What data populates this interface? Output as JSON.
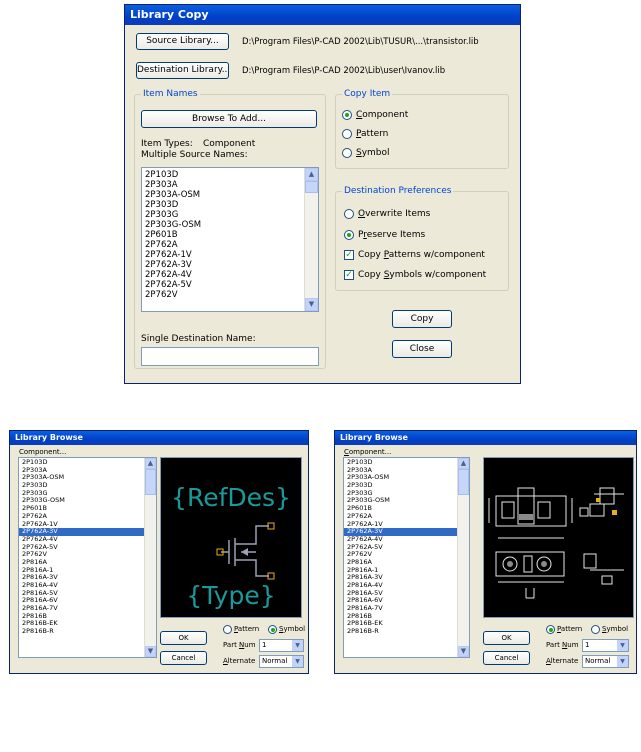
{
  "library_copy": {
    "title": "Library Copy",
    "source_button": "Source Library...",
    "source_path": "D:\\Program Files\\P-CAD 2002\\Lib\\TUSUR\\...\\transistor.lib",
    "destination_button": "Destination Library...",
    "destination_path": "D:\\Program Files\\P-CAD 2002\\Lib\\user\\Ivanov.lib",
    "item_names_group": "Item Names",
    "browse_button": "Browse To Add...",
    "item_types_label": "Item Types:",
    "item_types_value": "Component",
    "multiple_source_label": "Multiple Source Names:",
    "items": [
      "2P103D",
      "2P303A",
      "2P303A-OSM",
      "2P303D",
      "2P303G",
      "2P303G-OSM",
      "2P601B",
      "2P762A",
      "2P762A-1V",
      "2P762A-3V",
      "2P762A-4V",
      "2P762A-5V",
      "2P762V"
    ],
    "single_dest_label": "Single Destination Name:",
    "single_dest_value": "",
    "copy_item_group": "Copy Item",
    "copy_item_options": [
      "Component",
      "Pattern",
      "Symbol"
    ],
    "copy_item_selected": "Component",
    "dest_pref_group": "Destination Preferences",
    "overwrite_label": "Overwrite Items",
    "preserve_label": "Preserve Items",
    "preserve_selected": true,
    "copy_patterns_label": "Copy Patterns w/component",
    "copy_patterns_checked": true,
    "copy_symbols_label": "Copy Symbols w/component",
    "copy_symbols_checked": true,
    "copy_button": "Copy",
    "close_button": "Close"
  },
  "browse_left": {
    "title": "Library Browse",
    "component_label": "Component...",
    "items": [
      "2P103D",
      "2P303A",
      "2P303A-OSM",
      "2P303D",
      "2P303G",
      "2P303G-OSM",
      "2P601B",
      "2P762A",
      "2P762A-1V",
      "2P762A-3V",
      "2P762A-4V",
      "2P762A-5V",
      "2P762V",
      "2P816A",
      "2P816A-1",
      "2P816A-3V",
      "2P816A-4V",
      "2P816A-5V",
      "2P816A-6V",
      "2P816A-7V",
      "2P816B",
      "2P816B-EK",
      "2P816B-R"
    ],
    "selected_item": "2P762A-3V",
    "preview_refdes": "{RefDes}",
    "preview_type": "{Type}",
    "ok_button": "OK",
    "cancel_button": "Cancel",
    "pattern_label": "Pattern",
    "symbol_label": "Symbol",
    "view_selected": "Symbol",
    "part_num_label": "Part Num",
    "part_num_value": "1",
    "alternate_label": "Alternate",
    "alternate_value": "Normal"
  },
  "browse_right": {
    "title": "Library Browse",
    "component_label": "Component...",
    "items": [
      "2P103D",
      "2P303A",
      "2P303A-OSM",
      "2P303D",
      "2P303G",
      "2P303G-OSM",
      "2P601B",
      "2P762A",
      "2P762A-1V",
      "2P762A-3V",
      "2P762A-4V",
      "2P762A-5V",
      "2P762V",
      "2P816A",
      "2P816A-1",
      "2P816A-3V",
      "2P816A-4V",
      "2P816A-5V",
      "2P816A-6V",
      "2P816A-7V",
      "2P816B",
      "2P816B-EK",
      "2P816B-R"
    ],
    "selected_item": "2P762A-3V",
    "ok_button": "OK",
    "cancel_button": "Cancel",
    "pattern_label": "Pattern",
    "symbol_label": "Symbol",
    "view_selected": "Pattern",
    "part_num_label": "Part Num",
    "part_num_value": "1",
    "alternate_label": "Alternate",
    "alternate_value": "Normal"
  },
  "colors": {
    "titlebar": "#0040c8",
    "dialog_bg": "#ece9d8",
    "selection": "#316ac5",
    "symbol_teal": "#1a9a9a",
    "preview_bg": "#000000"
  }
}
